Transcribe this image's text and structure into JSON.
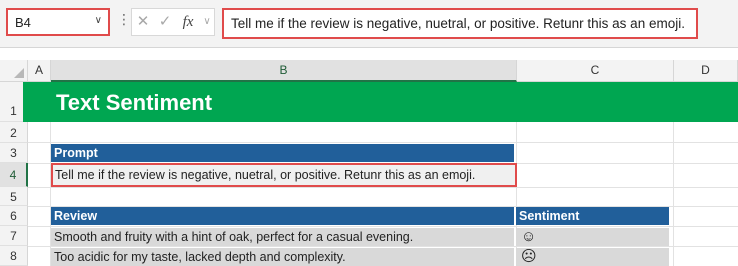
{
  "formula_bar": {
    "name_box": "B4",
    "fx_label": "fx",
    "formula": "Tell me if the review is negative, nuetral, or positive. Retunr this as an emoji."
  },
  "columns": [
    "A",
    "B",
    "C",
    "D"
  ],
  "rows": [
    "1",
    "2",
    "3",
    "4",
    "5",
    "6",
    "7",
    "8"
  ],
  "sheet": {
    "title": "Text Sentiment",
    "prompt_header": "Prompt",
    "prompt_text": "Tell me if the review is negative, nuetral, or positive. Retunr this as an emoji.",
    "review_header": "Review",
    "sentiment_header": "Sentiment",
    "reviews": [
      {
        "review": "Smooth and fruity with a hint of oak, perfect for a casual evening.",
        "sentiment": "☺"
      },
      {
        "review": "Too acidic for my taste, lacked depth and complexity.",
        "sentiment": "☹"
      }
    ]
  },
  "colors": {
    "title_band": "#00a651",
    "header_fill": "#215f9a",
    "data_fill": "#d9d9d9",
    "highlight_border": "#e04b4b",
    "selection_green": "#217346"
  }
}
